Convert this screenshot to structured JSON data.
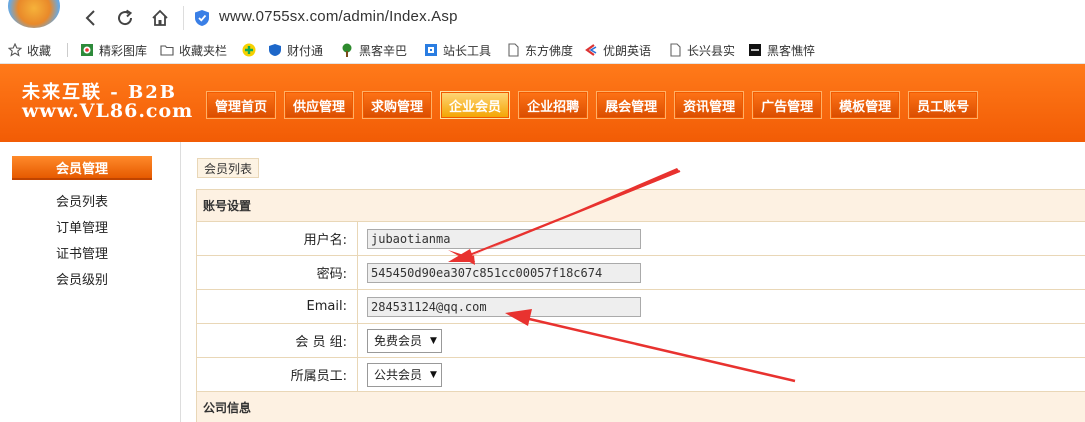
{
  "browser": {
    "url": "www.0755sx.com/admin/Index.Asp",
    "bookmarks": [
      "收藏",
      "精彩图库",
      "收藏夹栏",
      "财付通",
      "黑客辛巴",
      "站长工具",
      "东方佛度",
      "优朗英语",
      "长兴县实",
      "黑客憔悴"
    ]
  },
  "logo": {
    "line1": "未来互联 - B2B",
    "line2": "www.VL86.com"
  },
  "menu": [
    "管理首页",
    "供应管理",
    "求购管理",
    "企业会员",
    "企业招聘",
    "展会管理",
    "资讯管理",
    "广告管理",
    "模板管理",
    "员工账号"
  ],
  "menu_active": "企业会员",
  "sidebar": {
    "title": "会员管理",
    "links": [
      "会员列表",
      "订单管理",
      "证书管理",
      "会员级别"
    ]
  },
  "breadcrumb": "会员列表",
  "form": {
    "section_title": "账号设置",
    "username_label": "用户名:",
    "username_value": "jubaotianma",
    "password_label": "密码:",
    "password_value": "545450d90ea307c851cc00057f18c674",
    "email_label": "Email:",
    "email_value": "284531124@qq.com",
    "group_label": "会 员 组:",
    "group_value": "免费会员",
    "staff_label": "所属员工:",
    "staff_value": "公共会员",
    "next_section_title": "公司信息"
  },
  "colors": {
    "header_orange": "#f25c05",
    "arrow_red": "#e8322f",
    "row_border": "#e9d7b7"
  }
}
